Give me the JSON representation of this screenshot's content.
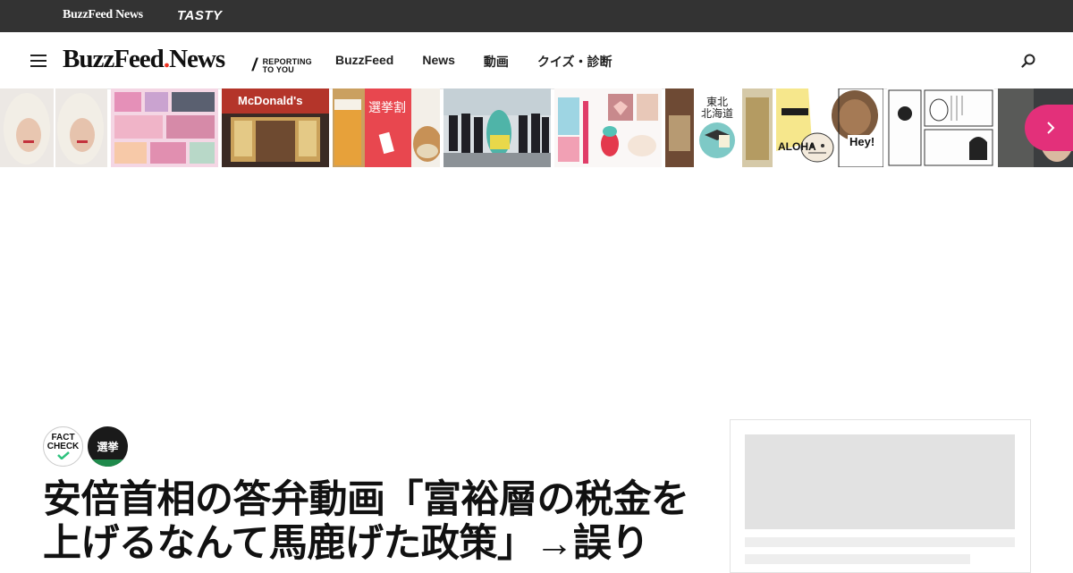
{
  "topbar": {
    "brand_news": "BuzzFeed News",
    "brand_tasty": "TASTY"
  },
  "header": {
    "logo_main": "BuzzFeed",
    "logo_news": "News",
    "tagline_slash": "/",
    "tagline_line1": "REPORTING",
    "tagline_line2": "TO YOU",
    "nav": [
      "BuzzFeed",
      "News",
      "動画",
      "クイズ・診断"
    ]
  },
  "thumbs": {
    "mcdonalds": "McDonald's",
    "election_sale": "選挙割",
    "tohoku_line1": "東北",
    "tohoku_line2": "北海道",
    "aloha": "ALOHA",
    "hey": "Hey!"
  },
  "article": {
    "badge_fact_line1": "FACT",
    "badge_fact_line2": "CHECK",
    "badge_election": "選挙",
    "headline_line1": "安倍首相の答弁動画「富裕層の税金を",
    "headline_line2": "上げるなんて馬鹿げた政策」→誤り"
  },
  "colors": {
    "accent": "#e3307a",
    "topbar": "#333333",
    "skeleton": "#e2e2e2"
  }
}
